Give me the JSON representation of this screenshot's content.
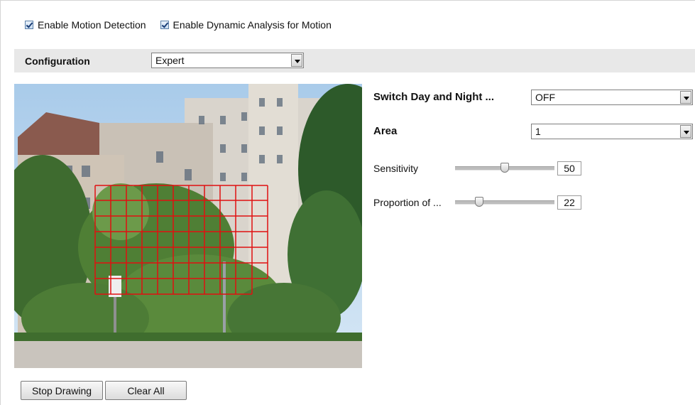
{
  "checkboxes": [
    {
      "label": "Enable Motion Detection",
      "checked": true
    },
    {
      "label": "Enable Dynamic Analysis for Motion",
      "checked": true
    }
  ],
  "configuration": {
    "label": "Configuration",
    "value": "Expert"
  },
  "settings": {
    "switch_day_night": {
      "label": "Switch Day and Night ...",
      "value": "OFF"
    },
    "area": {
      "label": "Area",
      "value": "1"
    },
    "sensitivity": {
      "label": "Sensitivity",
      "value": "50",
      "level": 0.5
    },
    "proportion": {
      "label": "Proportion of ...",
      "value": "22",
      "level": 0.22
    }
  },
  "buttons": {
    "stop_drawing": "Stop Drawing",
    "clear_all": "Clear All"
  },
  "colors": {
    "grid": "#e01010",
    "bar": "#e8e8e8",
    "sky": "#b9d6ef"
  },
  "video": {
    "icons": [
      "building",
      "trees",
      "lamp-post",
      "motion-grid"
    ]
  }
}
